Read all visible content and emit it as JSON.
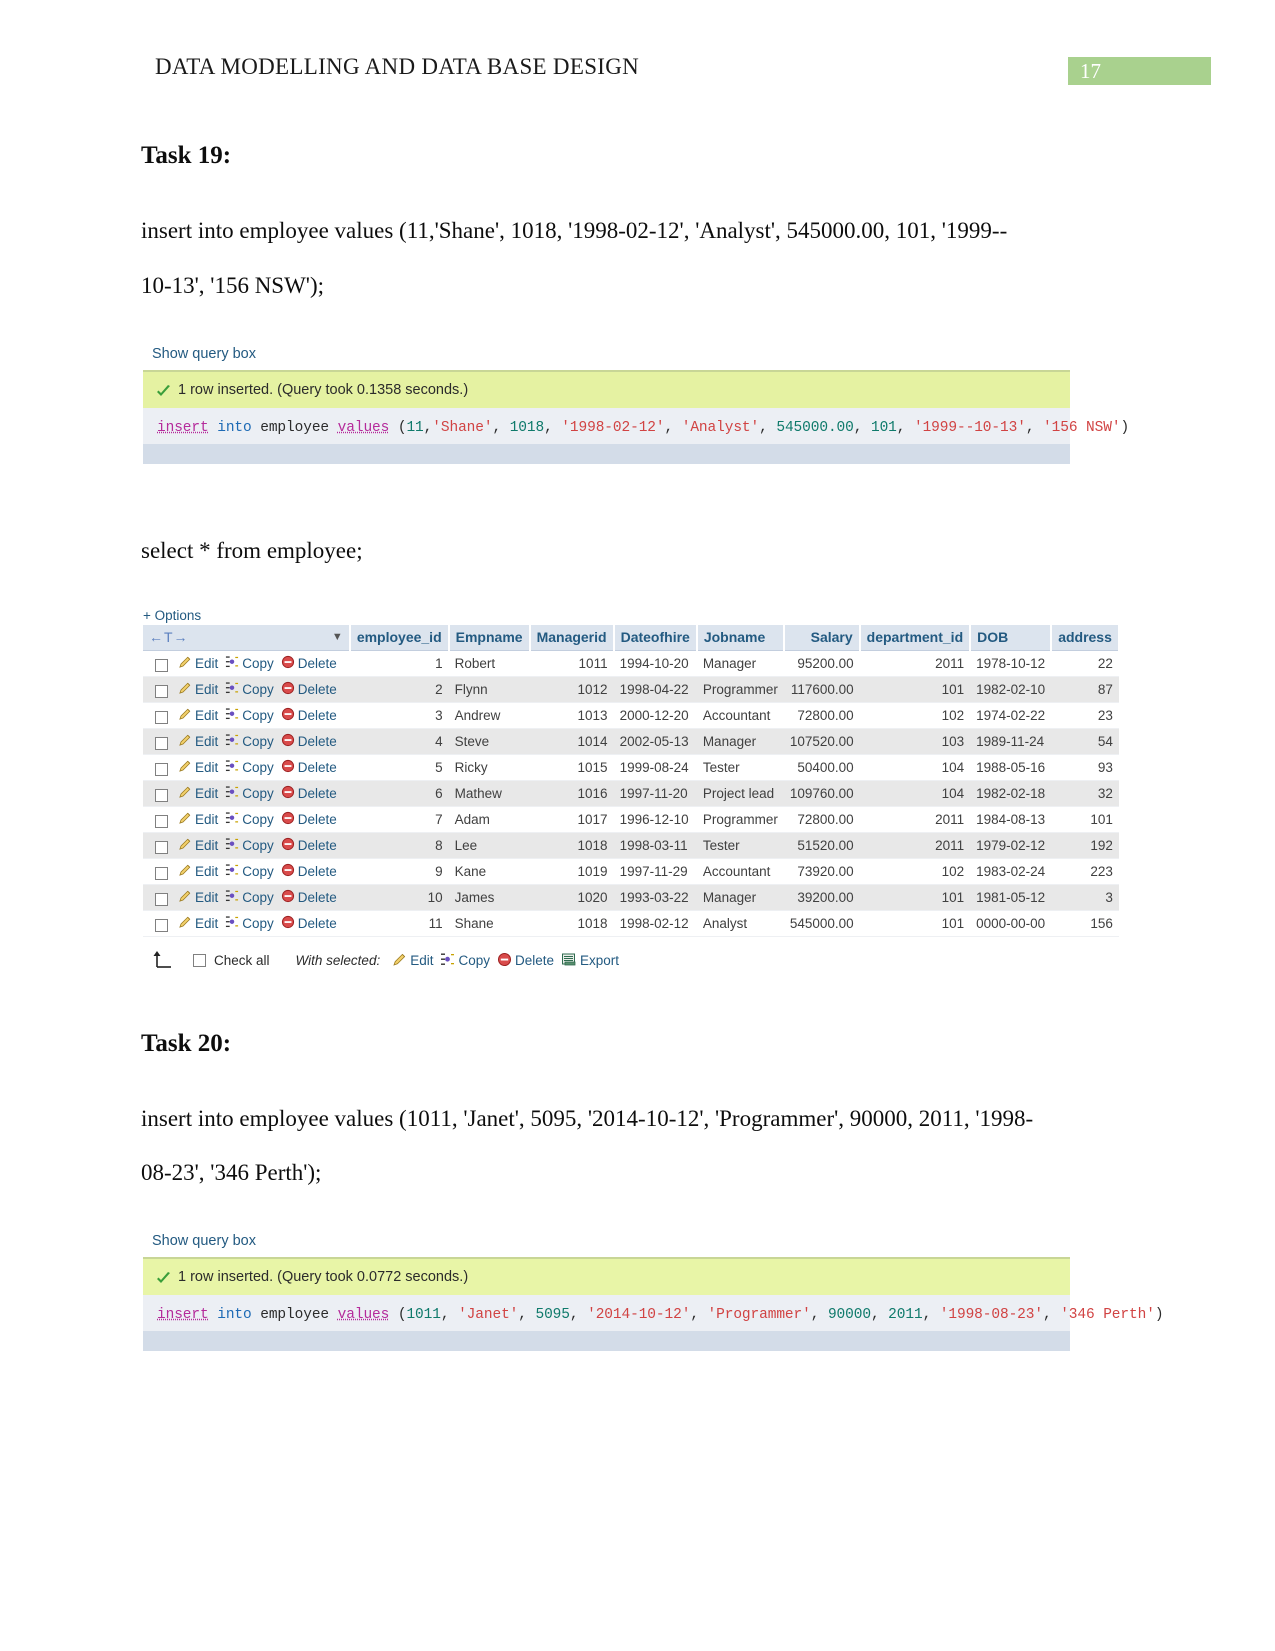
{
  "header": {
    "doc_title": "DATA MODELLING AND DATA BASE DESIGN",
    "page_number": "17",
    "accent_color": "#a9d18e"
  },
  "task19": {
    "heading": "Task 19:",
    "statement_line1": "insert into employee values (11,'Shane', 1018, '1998-02-12', 'Analyst', 545000.00, 101, '1999--",
    "statement_line2": "10-13', '156 NSW');",
    "result": {
      "show_query_box": "Show query box",
      "status": "1 row inserted. (Query took 0.1358 seconds.)",
      "sql_tokens": [
        {
          "t": "insert",
          "c": "kw"
        },
        {
          "t": " ",
          "c": "punc"
        },
        {
          "t": "into",
          "c": "kw2"
        },
        {
          "t": " employee ",
          "c": "ident"
        },
        {
          "t": "values",
          "c": "kw"
        },
        {
          "t": " (",
          "c": "punc"
        },
        {
          "t": "11",
          "c": "num"
        },
        {
          "t": ",",
          "c": "punc"
        },
        {
          "t": "'Shane'",
          "c": "str"
        },
        {
          "t": ", ",
          "c": "punc"
        },
        {
          "t": "1018",
          "c": "num"
        },
        {
          "t": ", ",
          "c": "punc"
        },
        {
          "t": "'1998-02-12'",
          "c": "str"
        },
        {
          "t": ", ",
          "c": "punc"
        },
        {
          "t": "'Analyst'",
          "c": "str"
        },
        {
          "t": ", ",
          "c": "punc"
        },
        {
          "t": "545000.00",
          "c": "num"
        },
        {
          "t": ", ",
          "c": "punc"
        },
        {
          "t": "101",
          "c": "num"
        },
        {
          "t": ", ",
          "c": "punc"
        },
        {
          "t": "'1999--10-13'",
          "c": "str"
        },
        {
          "t": ", ",
          "c": "punc"
        },
        {
          "t": "'156 NSW'",
          "c": "str"
        },
        {
          "t": ")",
          "c": "punc"
        }
      ]
    }
  },
  "select_statement": "select * from employee;",
  "results_table": {
    "options_label": "+ Options",
    "columns": [
      {
        "label": "employee_id",
        "align": "num"
      },
      {
        "label": "Empname",
        "align": "txt"
      },
      {
        "label": "Managerid",
        "align": "num"
      },
      {
        "label": "Dateofhire",
        "align": "txt"
      },
      {
        "label": "Jobname",
        "align": "txt"
      },
      {
        "label": "Salary",
        "align": "num"
      },
      {
        "label": "department_id",
        "align": "num"
      },
      {
        "label": "DOB",
        "align": "txt"
      },
      {
        "label": "address",
        "align": "num"
      }
    ],
    "row_actions": {
      "edit": "Edit",
      "copy": "Copy",
      "delete": "Delete"
    },
    "rows": [
      {
        "employee_id": "1",
        "Empname": "Robert",
        "Managerid": "1011",
        "Dateofhire": "1994-10-20",
        "Jobname": "Manager",
        "Salary": "95200.00",
        "department_id": "2011",
        "DOB": "1978-10-12",
        "address": "22"
      },
      {
        "employee_id": "2",
        "Empname": "Flynn",
        "Managerid": "1012",
        "Dateofhire": "1998-04-22",
        "Jobname": "Programmer",
        "Salary": "117600.00",
        "department_id": "101",
        "DOB": "1982-02-10",
        "address": "87"
      },
      {
        "employee_id": "3",
        "Empname": "Andrew",
        "Managerid": "1013",
        "Dateofhire": "2000-12-20",
        "Jobname": "Accountant",
        "Salary": "72800.00",
        "department_id": "102",
        "DOB": "1974-02-22",
        "address": "23"
      },
      {
        "employee_id": "4",
        "Empname": "Steve",
        "Managerid": "1014",
        "Dateofhire": "2002-05-13",
        "Jobname": "Manager",
        "Salary": "107520.00",
        "department_id": "103",
        "DOB": "1989-11-24",
        "address": "54"
      },
      {
        "employee_id": "5",
        "Empname": "Ricky",
        "Managerid": "1015",
        "Dateofhire": "1999-08-24",
        "Jobname": "Tester",
        "Salary": "50400.00",
        "department_id": "104",
        "DOB": "1988-05-16",
        "address": "93"
      },
      {
        "employee_id": "6",
        "Empname": "Mathew",
        "Managerid": "1016",
        "Dateofhire": "1997-11-20",
        "Jobname": "Project lead",
        "Salary": "109760.00",
        "department_id": "104",
        "DOB": "1982-02-18",
        "address": "32"
      },
      {
        "employee_id": "7",
        "Empname": "Adam",
        "Managerid": "1017",
        "Dateofhire": "1996-12-10",
        "Jobname": "Programmer",
        "Salary": "72800.00",
        "department_id": "2011",
        "DOB": "1984-08-13",
        "address": "101"
      },
      {
        "employee_id": "8",
        "Empname": "Lee",
        "Managerid": "1018",
        "Dateofhire": "1998-03-11",
        "Jobname": "Tester",
        "Salary": "51520.00",
        "department_id": "2011",
        "DOB": "1979-02-12",
        "address": "192"
      },
      {
        "employee_id": "9",
        "Empname": "Kane",
        "Managerid": "1019",
        "Dateofhire": "1997-11-29",
        "Jobname": "Accountant",
        "Salary": "73920.00",
        "department_id": "102",
        "DOB": "1983-02-24",
        "address": "223"
      },
      {
        "employee_id": "10",
        "Empname": "James",
        "Managerid": "1020",
        "Dateofhire": "1993-03-22",
        "Jobname": "Manager",
        "Salary": "39200.00",
        "department_id": "101",
        "DOB": "1981-05-12",
        "address": "3"
      },
      {
        "employee_id": "11",
        "Empname": "Shane",
        "Managerid": "1018",
        "Dateofhire": "1998-02-12",
        "Jobname": "Analyst",
        "Salary": "545000.00",
        "department_id": "101",
        "DOB": "0000-00-00",
        "address": "156"
      }
    ],
    "footer": {
      "check_all": "Check all",
      "with_selected": "With selected:",
      "edit": "Edit",
      "copy": "Copy",
      "delete": "Delete",
      "export": "Export"
    }
  },
  "task20": {
    "heading": "Task 20:",
    "statement_line1": "insert into employee values (1011, 'Janet', 5095, '2014-10-12', 'Programmer', 90000, 2011, '1998-",
    "statement_line2": "08-23', '346 Perth');",
    "result": {
      "show_query_box": "Show query box",
      "status": "1 row inserted. (Query took 0.0772 seconds.)",
      "sql_tokens": [
        {
          "t": "insert",
          "c": "kw"
        },
        {
          "t": " ",
          "c": "punc"
        },
        {
          "t": "into",
          "c": "kw2"
        },
        {
          "t": " employee ",
          "c": "ident"
        },
        {
          "t": "values",
          "c": "kw"
        },
        {
          "t": " (",
          "c": "punc"
        },
        {
          "t": "1011",
          "c": "num"
        },
        {
          "t": ", ",
          "c": "punc"
        },
        {
          "t": "'Janet'",
          "c": "str"
        },
        {
          "t": ", ",
          "c": "punc"
        },
        {
          "t": "5095",
          "c": "num"
        },
        {
          "t": ", ",
          "c": "punc"
        },
        {
          "t": "'2014-10-12'",
          "c": "str"
        },
        {
          "t": ", ",
          "c": "punc"
        },
        {
          "t": "'Programmer'",
          "c": "str"
        },
        {
          "t": ", ",
          "c": "punc"
        },
        {
          "t": "90000",
          "c": "num"
        },
        {
          "t": ", ",
          "c": "punc"
        },
        {
          "t": "2011",
          "c": "num"
        },
        {
          "t": ", ",
          "c": "punc"
        },
        {
          "t": "'1998-08-23'",
          "c": "str"
        },
        {
          "t": ", ",
          "c": "punc"
        },
        {
          "t": "'346 Perth'",
          "c": "str"
        },
        {
          "t": ")",
          "c": "punc"
        }
      ]
    }
  }
}
